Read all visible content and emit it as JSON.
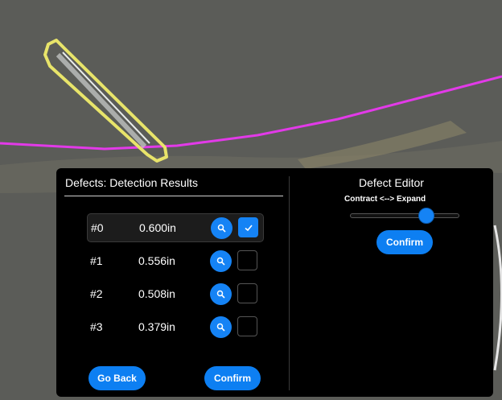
{
  "defects_panel": {
    "title": "Defects: Detection Results",
    "rows": [
      {
        "id": "#0",
        "value": "0.600in",
        "checked": true,
        "selected": true
      },
      {
        "id": "#1",
        "value": "0.556in",
        "checked": false,
        "selected": false
      },
      {
        "id": "#2",
        "value": "0.508in",
        "checked": false,
        "selected": false
      },
      {
        "id": "#3",
        "value": "0.379in",
        "checked": false,
        "selected": false
      }
    ],
    "go_back_label": "Go Back",
    "confirm_label": "Confirm"
  },
  "defect_editor": {
    "title": "Defect Editor",
    "slider_label": "Contract <--> Expand",
    "slider_value_fraction": 0.7,
    "confirm_label": "Confirm"
  },
  "colors": {
    "accent_blue": "#1583f5",
    "defect_outline": "#e8e46a",
    "path_line": "#e23ae8",
    "panel_bg": "#000000",
    "background": "#5a5b57"
  }
}
